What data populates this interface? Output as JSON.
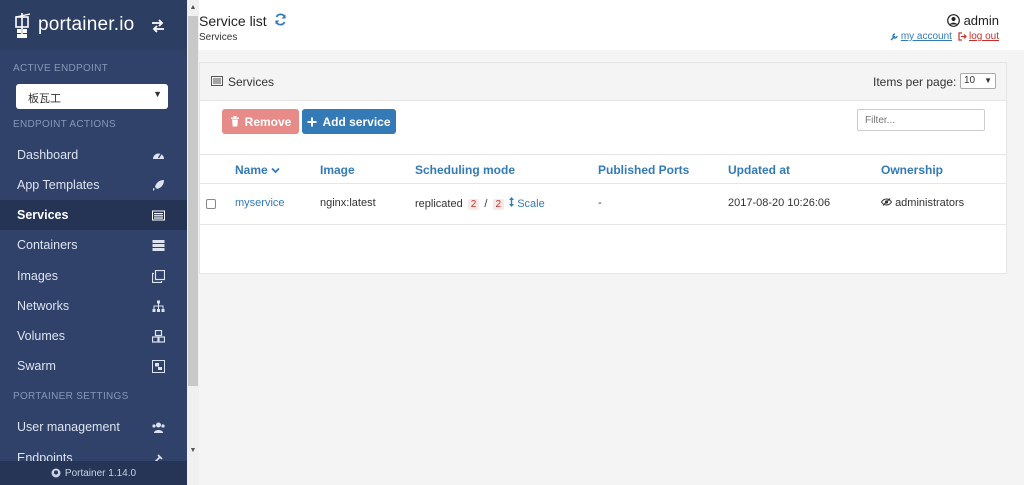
{
  "brand": {
    "name": "portainer.io"
  },
  "sidebar": {
    "active_endpoint_title": "ACTIVE ENDPOINT",
    "endpoint_value": "板瓦工",
    "endpoint_actions_title": "ENDPOINT ACTIONS",
    "items": [
      {
        "label": "Dashboard",
        "icon": "tachometer-icon"
      },
      {
        "label": "App Templates",
        "icon": "rocket-icon"
      },
      {
        "label": "Services",
        "icon": "list-alt-icon",
        "active": true
      },
      {
        "label": "Containers",
        "icon": "server-icon"
      },
      {
        "label": "Images",
        "icon": "clone-icon"
      },
      {
        "label": "Networks",
        "icon": "sitemap-icon"
      },
      {
        "label": "Volumes",
        "icon": "cubes-icon"
      },
      {
        "label": "Swarm",
        "icon": "object-group-icon"
      }
    ],
    "settings_title": "PORTAINER SETTINGS",
    "settings_items": [
      {
        "label": "User management",
        "icon": "users-icon"
      },
      {
        "label": "Endpoints",
        "icon": "plug-icon"
      }
    ],
    "footer": "Portainer 1.14.0"
  },
  "header": {
    "title": "Service list",
    "breadcrumb": "Services",
    "username": "admin",
    "my_account": "my account",
    "logout": "log out"
  },
  "widget": {
    "title": "Services",
    "items_per_page_label": "Items per page:",
    "items_per_page_value": "10",
    "remove_label": "Remove",
    "add_label": "Add service",
    "filter_placeholder": "Filter..."
  },
  "table": {
    "columns": [
      "Name",
      "Image",
      "Scheduling mode",
      "Published Ports",
      "Updated at",
      "Ownership"
    ],
    "rows": [
      {
        "name": "myservice",
        "image": "nginx:latest",
        "mode": "replicated",
        "running": "2",
        "separator": "/",
        "desired": "2",
        "scale": "Scale",
        "ports": "-",
        "updated": "2017-08-20 10:26:06",
        "ownership": "administrators"
      }
    ]
  },
  "colors": {
    "sidebar_bg": "#30426a",
    "primary": "#337ab7",
    "danger_light": "#e78b88"
  }
}
